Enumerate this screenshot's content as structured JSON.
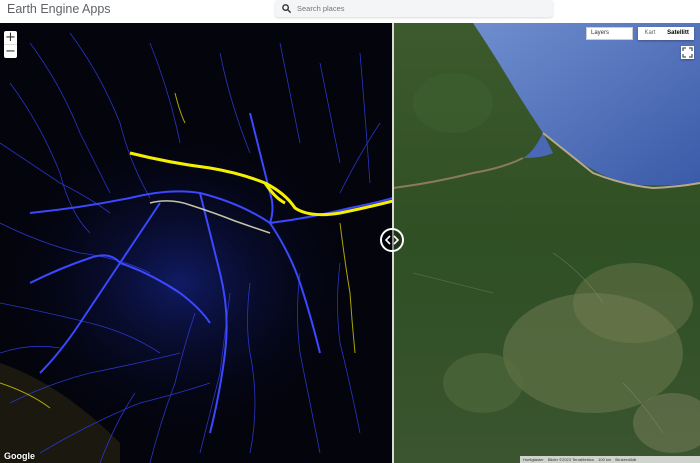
{
  "header": {
    "title": "Earth Engine Apps",
    "search": {
      "placeholder": "Search places"
    }
  },
  "map": {
    "zoom_in": "+",
    "zoom_out": "−",
    "layers_label": "Layers",
    "map_types": [
      "Kart",
      "Satellitt"
    ],
    "selected_map_type": "Satellitt",
    "google_logo": "Google",
    "attribution": [
      "Hurtigtaster",
      "Bilder ©2023 TerraMetrics",
      "100 km",
      "Brukervilkår"
    ]
  },
  "colors": {
    "river_blue": "#3b48ff",
    "river_yellow": "#f5f000",
    "ocean": "#4b68b8",
    "forest": "#2f4e24"
  }
}
